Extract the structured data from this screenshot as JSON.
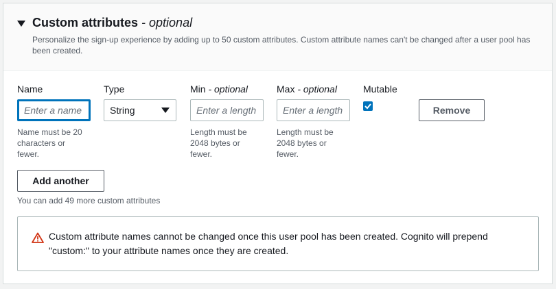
{
  "section": {
    "title": "Custom attributes",
    "title_optional": "- optional",
    "description": "Personalize the sign-up experience by adding up to 50 custom attributes. Custom attribute names can't be changed after a user pool has been created."
  },
  "form": {
    "name": {
      "label": "Name",
      "placeholder": "Enter a name",
      "value": "",
      "hint": "Name must be 20 characters or fewer."
    },
    "type": {
      "label": "Type",
      "selected": "String"
    },
    "min": {
      "label": "Min",
      "label_optional": "- optional",
      "placeholder": "Enter a length",
      "value": "",
      "hint": "Length must be 2048 bytes or fewer."
    },
    "max": {
      "label": "Max",
      "label_optional": "- optional",
      "placeholder": "Enter a length",
      "value": "",
      "hint": "Length must be 2048 bytes or fewer."
    },
    "mutable": {
      "label": "Mutable",
      "checked": true
    },
    "remove_label": "Remove"
  },
  "add_another_label": "Add another",
  "remaining_text": "You can add 49 more custom attributes",
  "alert": {
    "icon": "warning-icon",
    "message": "Custom attribute names cannot be changed once this user pool has been created. Cognito will prepend \"custom:\" to your attribute names once they are created."
  },
  "colors": {
    "accent": "#0073bb",
    "warning": "#d13212",
    "border": "#aab7b8",
    "muted_text": "#545b64"
  }
}
